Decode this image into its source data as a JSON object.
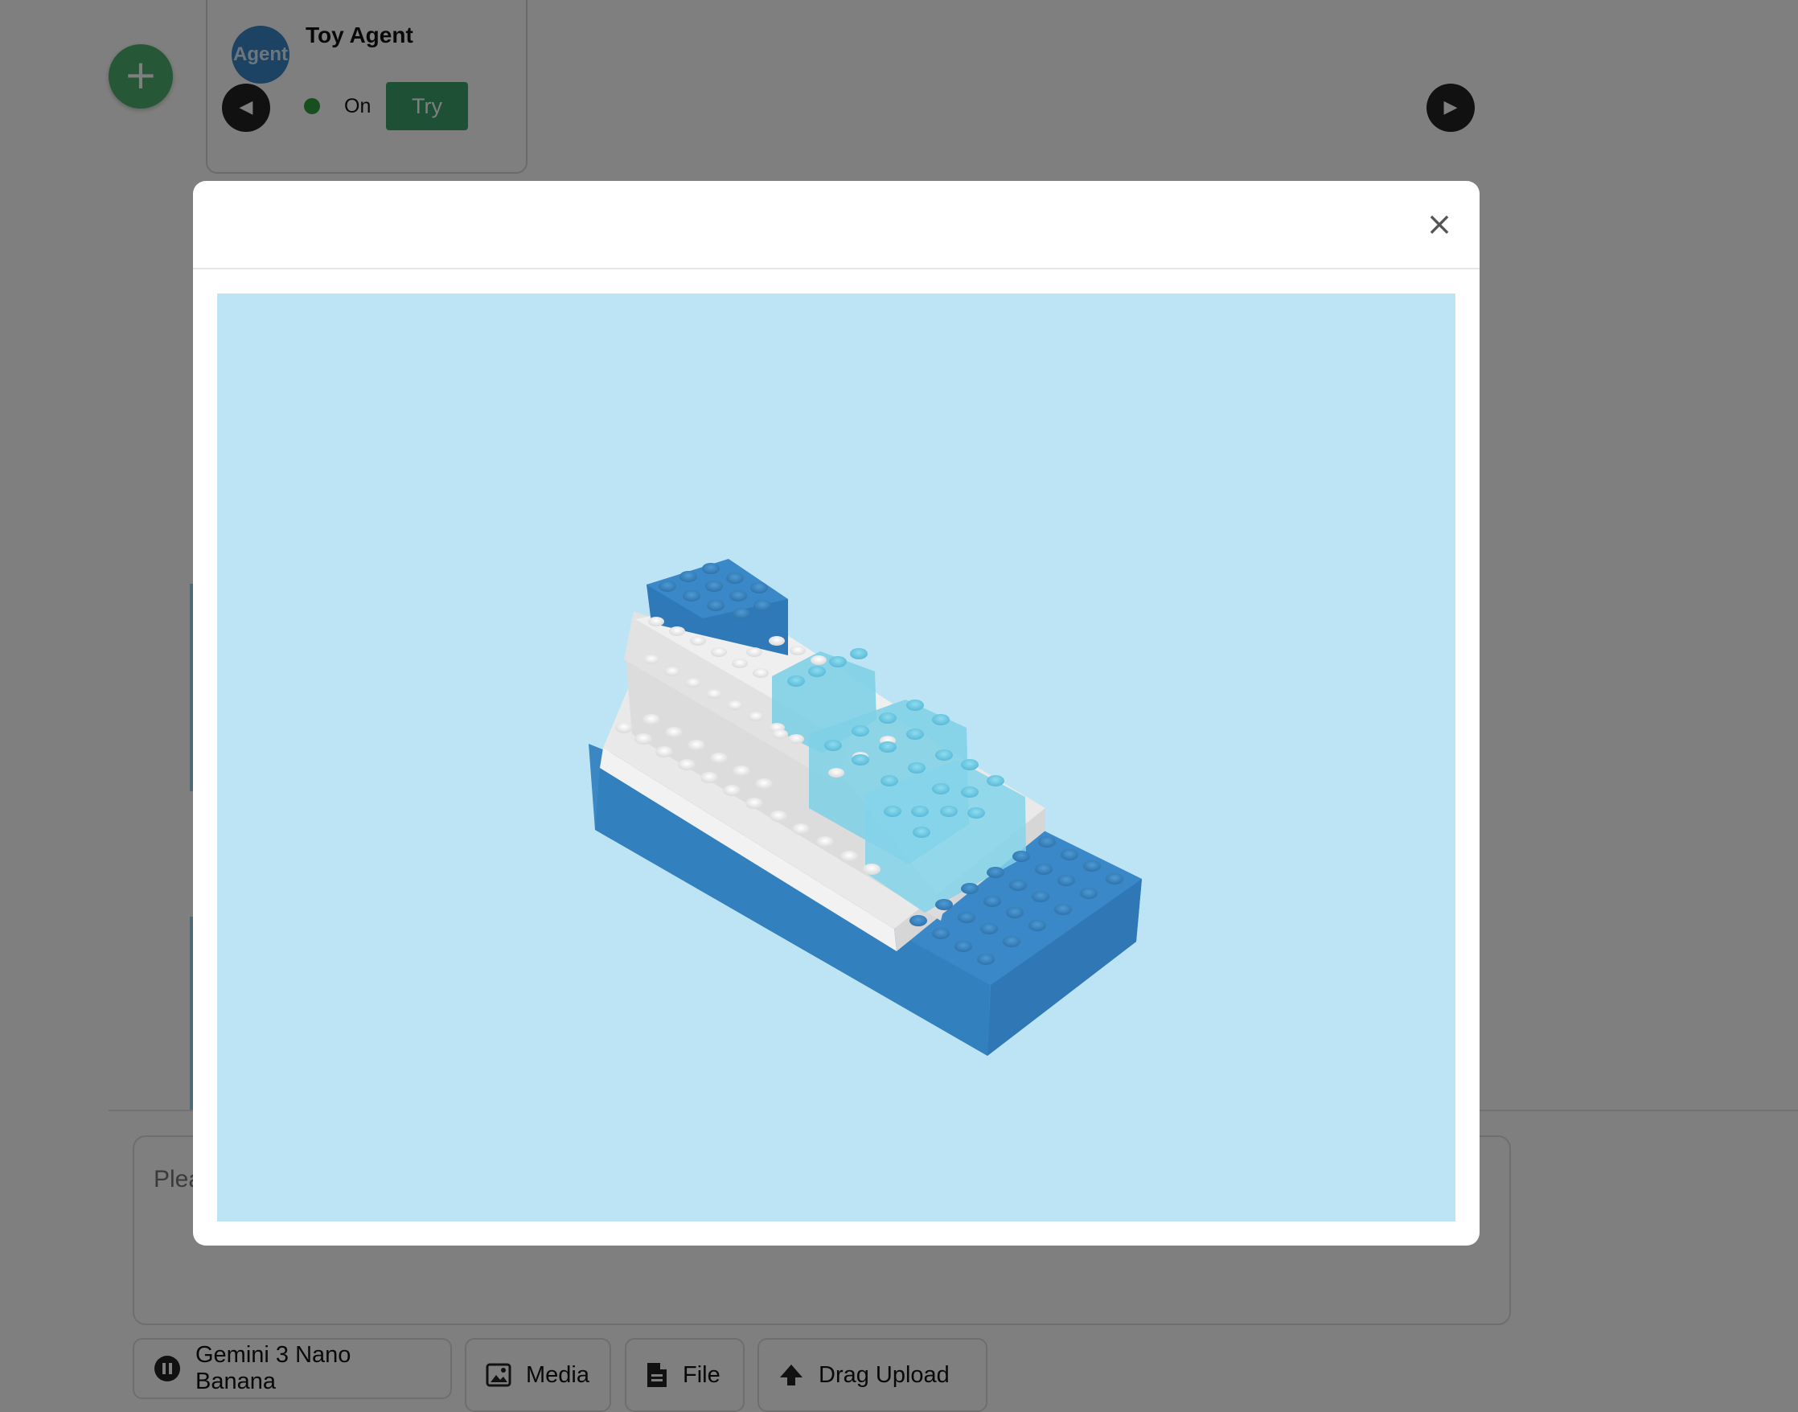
{
  "agent_card": {
    "avatar_text": "Agent",
    "name": "Toy Agent",
    "status": "On",
    "try_label": "Try"
  },
  "fab": {
    "icon": "plus-icon",
    "glyph": "+"
  },
  "nav": {
    "prev_glyph": "◀",
    "next_glyph": "▶"
  },
  "composer": {
    "placeholder": "Plea"
  },
  "toolbar": {
    "model_label": "Gemini 3 Nano Banana",
    "media_label": "Media",
    "file_label": "File",
    "upload_label": "Drag Upload"
  },
  "modal": {
    "close_glyph": "×",
    "image_subject": "lego-boat"
  },
  "colors": {
    "accent_green": "#3aa16a",
    "avatar_blue": "#3a86c8",
    "image_background": "#bce4f4",
    "hull_blue": "#3b87c4",
    "deck_white": "#e9e9e9",
    "window_cyan": "#7fd0e6"
  }
}
